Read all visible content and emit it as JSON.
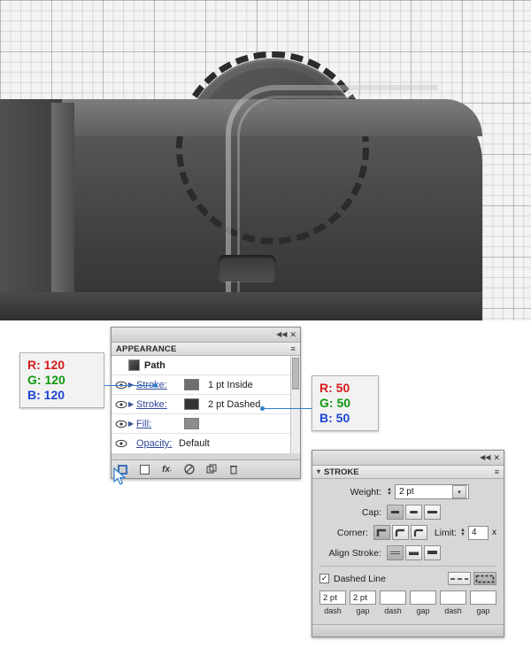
{
  "artwork": {
    "description": "Grayscale vector illustration of a dark rounded device body with a large dashed-stroke circular dial on a light grid background"
  },
  "appearance_panel": {
    "tab_label": "APPEARANCE",
    "menu_icon": "panel-menu-icon",
    "collapse_icon": "collapse-icon",
    "close_icon": "close-icon",
    "rows": [
      {
        "name": "Path",
        "type": "header",
        "thumb": "path-thumbnail",
        "value": ""
      },
      {
        "name": "Stroke:",
        "type": "stroke",
        "value": "1 pt  Inside",
        "swatch": "#6f6f6f",
        "selected": true
      },
      {
        "name": "Stroke:",
        "type": "stroke",
        "value": "2 pt Dashed",
        "swatch": "#323232",
        "selected": false
      },
      {
        "name": "Fill:",
        "type": "fill",
        "value": "",
        "swatch": "#8d8d8d",
        "selected": false
      },
      {
        "name": "Opacity:",
        "type": "opacity",
        "value": "Default",
        "swatch": "",
        "selected": false
      }
    ],
    "bottom_icons": [
      "new-art-has-basic-appearance-icon",
      "add-new-stroke-icon",
      "add-new-effect-icon",
      "clear-appearance-icon",
      "duplicate-item-icon",
      "delete-item-icon"
    ]
  },
  "stroke_panel": {
    "title": "STROKE",
    "menu_icon": "panel-menu-icon",
    "weight_label": "Weight:",
    "weight_value": "2 pt",
    "cap_label": "Cap:",
    "corner_label": "Corner:",
    "limit_label": "Limit:",
    "limit_value": "4",
    "limit_unit": "x",
    "align_label": "Align Stroke:",
    "dashed_line_label": "Dashed Line",
    "dashed_line_checked": "✓",
    "dash_fields": [
      "2 pt",
      "2 pt",
      "",
      "",
      "",
      ""
    ],
    "dash_captions": [
      "dash",
      "gap",
      "dash",
      "gap",
      "dash",
      "gap"
    ]
  },
  "callouts": {
    "gray120": {
      "r": "R: 120",
      "g": "G: 120",
      "b": "B: 120"
    },
    "gray50": {
      "r": "R: 50",
      "g": "G: 50",
      "b": "B: 50"
    }
  }
}
